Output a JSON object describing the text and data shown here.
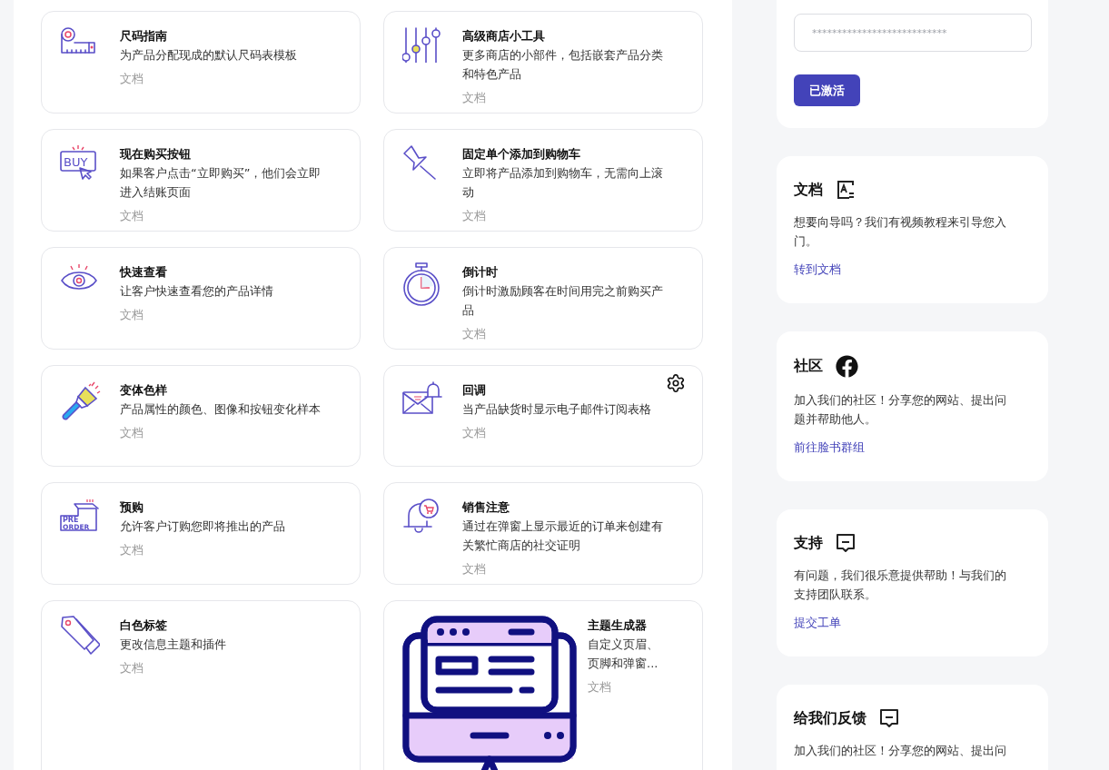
{
  "features": [
    {
      "kind": "standard",
      "title": "尺码指南",
      "description": "为产品分配现成的默认尺码表模板",
      "doc_link": "文档",
      "has_settings": false
    },
    {
      "kind": "standard",
      "title": "高级商店小工具",
      "description": "更多商店的小部件，包括嵌套产品分类和特色产品",
      "doc_link": "文档",
      "has_settings": false
    },
    {
      "kind": "standard",
      "title": "现在购买按钮",
      "description": "如果客户点击“立即购买”，他们会立即进入结账页面",
      "doc_link": "文档",
      "has_settings": false,
      "icon_text": [
        "BUY"
      ]
    },
    {
      "kind": "standard",
      "title": "固定单个添加到购物车",
      "description": "立即将产品添加到购物车，无需向上滚动",
      "doc_link": "文档",
      "has_settings": false
    },
    {
      "kind": "standard",
      "title": "快速查看",
      "description": "让客户快速查看您的产品详情",
      "doc_link": "文档",
      "has_settings": false
    },
    {
      "kind": "standard",
      "title": "倒计时",
      "description": "倒计时激励顾客在时间用完之前购买产品",
      "doc_link": "文档",
      "has_settings": false
    },
    {
      "kind": "standard",
      "title": "变体色样",
      "description": "产品属性的颜色、图像和按钮变化样本",
      "doc_link": "文档",
      "has_settings": false
    },
    {
      "kind": "standard",
      "title": "回调",
      "description": "当产品缺货时显示电子邮件订阅表格",
      "doc_link": "文档",
      "has_settings": true
    },
    {
      "kind": "standard",
      "title": "预购",
      "description": "允许客户订购您即将推出的产品",
      "doc_link": "文档",
      "has_settings": false,
      "icon_text": [
        "PRE",
        "ORDER"
      ]
    },
    {
      "kind": "standard",
      "title": "销售注意",
      "description": "通过在弹窗上显示最近的订单来创建有关繁忙商店的社交证明",
      "doc_link": "文档",
      "has_settings": false
    },
    {
      "kind": "standard",
      "title": "白色标签",
      "description": "更改信息主题和插件",
      "doc_link": "文档",
      "has_settings": false
    },
    {
      "kind": "featured",
      "title": "主题生成器",
      "description": "自定义页眉、页脚和弹窗...",
      "doc_link": "文档",
      "has_settings": false
    }
  ],
  "license": {
    "placeholder": "***************************",
    "button": "已激活"
  },
  "help_cards": [
    {
      "title": "文档",
      "description": "想要向导吗？我们有视频教程来引导您入门。",
      "link": "转到文档"
    },
    {
      "title": "社区",
      "description": "加入我们的社区！分享您的网站、提出问题并帮助他人。",
      "link": "前往脸书群组"
    },
    {
      "title": "支持",
      "description": "有问题，我们很乐意提供帮助！与我们的支持团队联系。",
      "link": "提交工单"
    },
    {
      "title": "给我们反馈",
      "description": "加入我们的社区！分享您的网站、提出问"
    }
  ]
}
